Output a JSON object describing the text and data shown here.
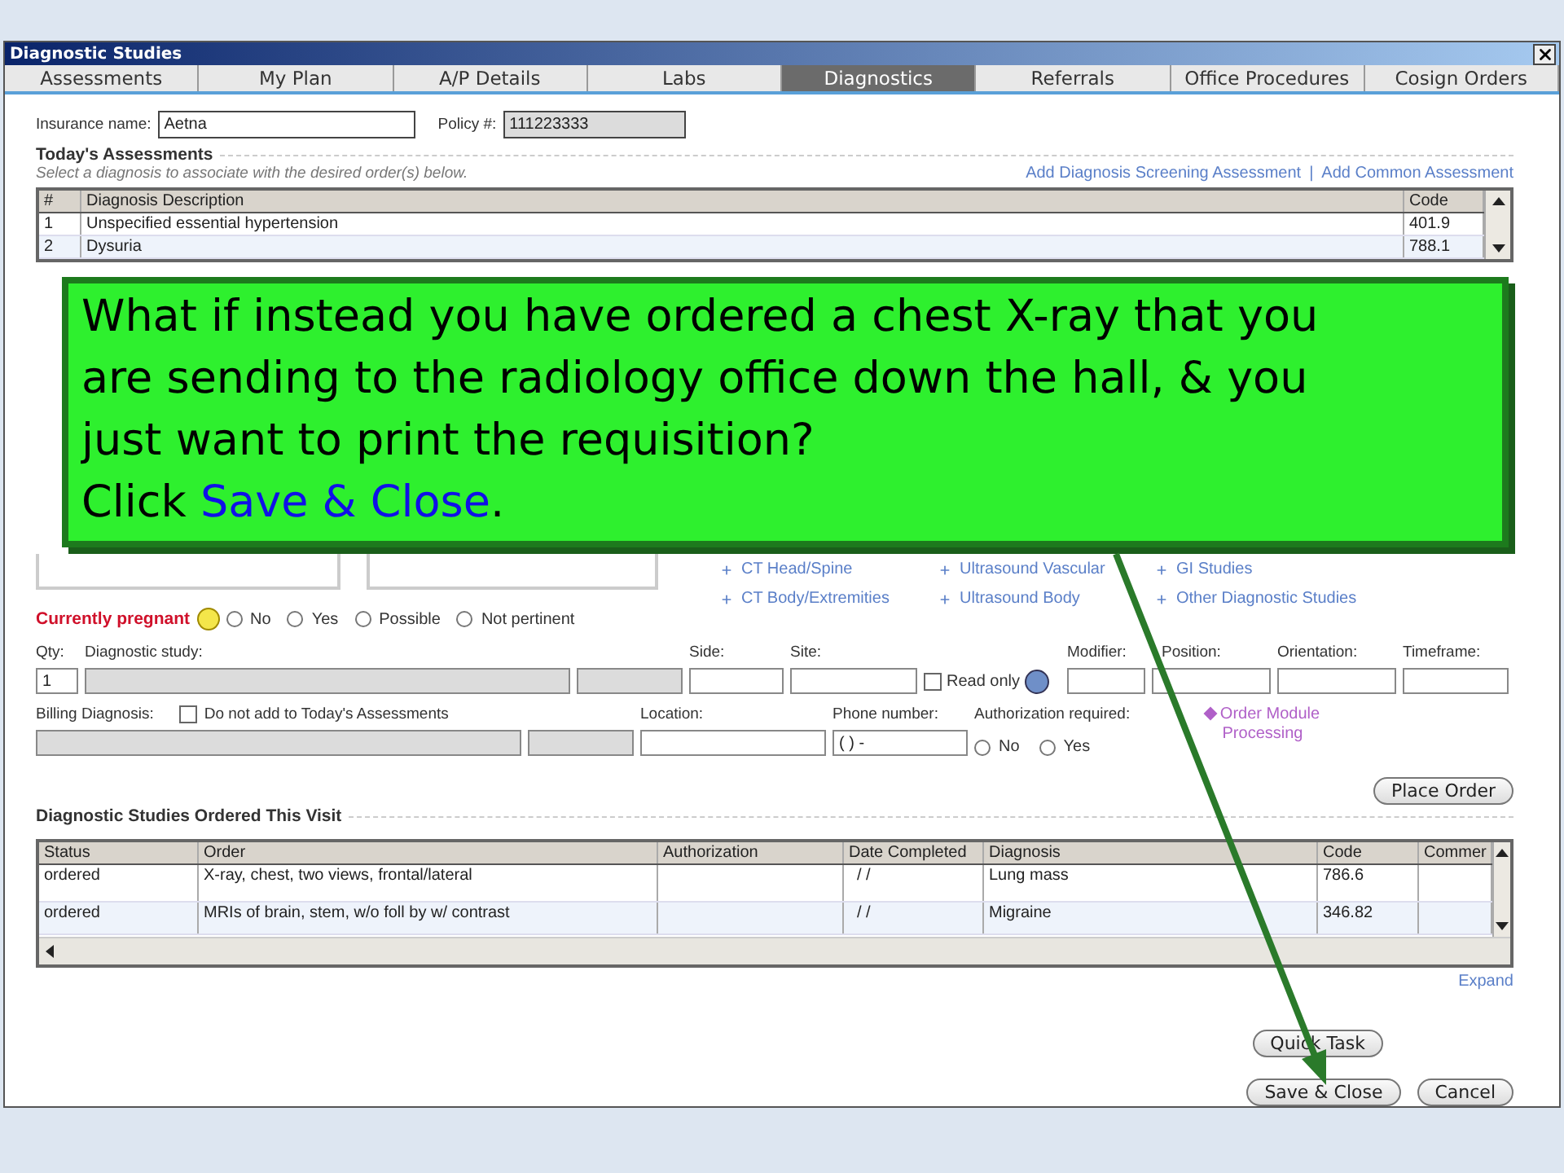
{
  "window": {
    "title": "Diagnostic Studies"
  },
  "tabs": [
    {
      "label": "Assessments",
      "selected": false
    },
    {
      "label": "My Plan",
      "selected": false
    },
    {
      "label": "A/P Details",
      "selected": false
    },
    {
      "label": "Labs",
      "selected": false
    },
    {
      "label": "Diagnostics",
      "selected": true
    },
    {
      "label": "Referrals",
      "selected": false
    },
    {
      "label": "Office Procedures",
      "selected": false
    },
    {
      "label": "Cosign Orders",
      "selected": false
    }
  ],
  "insurance": {
    "name_label": "Insurance name:",
    "name_value": "Aetna",
    "policy_label": "Policy #:",
    "policy_value": "111223333"
  },
  "assessments": {
    "heading": "Today's Assessments",
    "hint": "Select a diagnosis to associate with the desired order(s) below.",
    "links": [
      "Add Diagnosis Screening Assessment",
      "Add Common Assessment"
    ],
    "separator": "|",
    "columns": [
      "#",
      "Diagnosis Description",
      "Code"
    ],
    "rows": [
      {
        "num": "1",
        "description": "Unspecified essential hypertension",
        "code": "401.9"
      },
      {
        "num": "2",
        "description": "Dysuria",
        "code": "788.1"
      }
    ]
  },
  "study_links": [
    "CT Head/Spine",
    "Ultrasound Vascular",
    "GI Studies",
    "CT Body/Extremities",
    "Ultrasound Body",
    "Other Diagnostic Studies"
  ],
  "pregnancy": {
    "label": "Currently pregnant",
    "options": [
      {
        "label": "No",
        "selected": false
      },
      {
        "label": "Yes",
        "selected": false
      },
      {
        "label": "Possible",
        "selected": false
      },
      {
        "label": "Not pertinent",
        "selected": false
      }
    ]
  },
  "order_form": {
    "qty_label": "Qty:",
    "qty_value": "1",
    "study_label": "Diagnostic study:",
    "side_label": "Side:",
    "site_label": "Site:",
    "read_only": {
      "label": "Read only",
      "checked": false
    },
    "modifier_label": "Modifier:",
    "position_label": "Position:",
    "orientation_label": "Orientation:",
    "timeframe_label": "Timeframe:"
  },
  "billing": {
    "label": "Billing Diagnosis:",
    "exclude": {
      "label": "Do not add to Today's Assessments",
      "checked": false
    },
    "location_label": "Location:",
    "phone_label": "Phone number:",
    "phone_value": "( )  -",
    "authorization_label": "Authorization required:",
    "authorization_options": [
      {
        "label": "No",
        "selected": false
      },
      {
        "label": "Yes",
        "selected": false
      }
    ],
    "module_link": "Order Module Processing"
  },
  "place_order_button": "Place Order",
  "ordered": {
    "heading": "Diagnostic Studies Ordered This Visit",
    "columns": [
      "Status",
      "Order",
      "Authorization",
      "Date Completed",
      "Diagnosis",
      "Code",
      "Commer"
    ],
    "rows": [
      {
        "status": "ordered",
        "order": "X-ray, chest, two views, frontal/lateral",
        "date_completed": "/ /",
        "diagnosis": "Lung mass",
        "code": "786.6"
      },
      {
        "status": "ordered",
        "order": "MRIs of brain, stem, w/o foll by w/ contrast",
        "date_completed": "/ /",
        "diagnosis": "Migraine",
        "code": "346.82"
      }
    ]
  },
  "expand_link": "Expand",
  "footer_buttons": [
    "Quick Task",
    "Save & Close",
    "Cancel"
  ],
  "callout": {
    "text": "What if instead you have ordered a chest X-ray that you are sending to the radiology office down the hall, & you just want to print the requisition?",
    "instruction": {
      "before": "Click",
      "link": "Save & Close",
      "after": "."
    }
  }
}
